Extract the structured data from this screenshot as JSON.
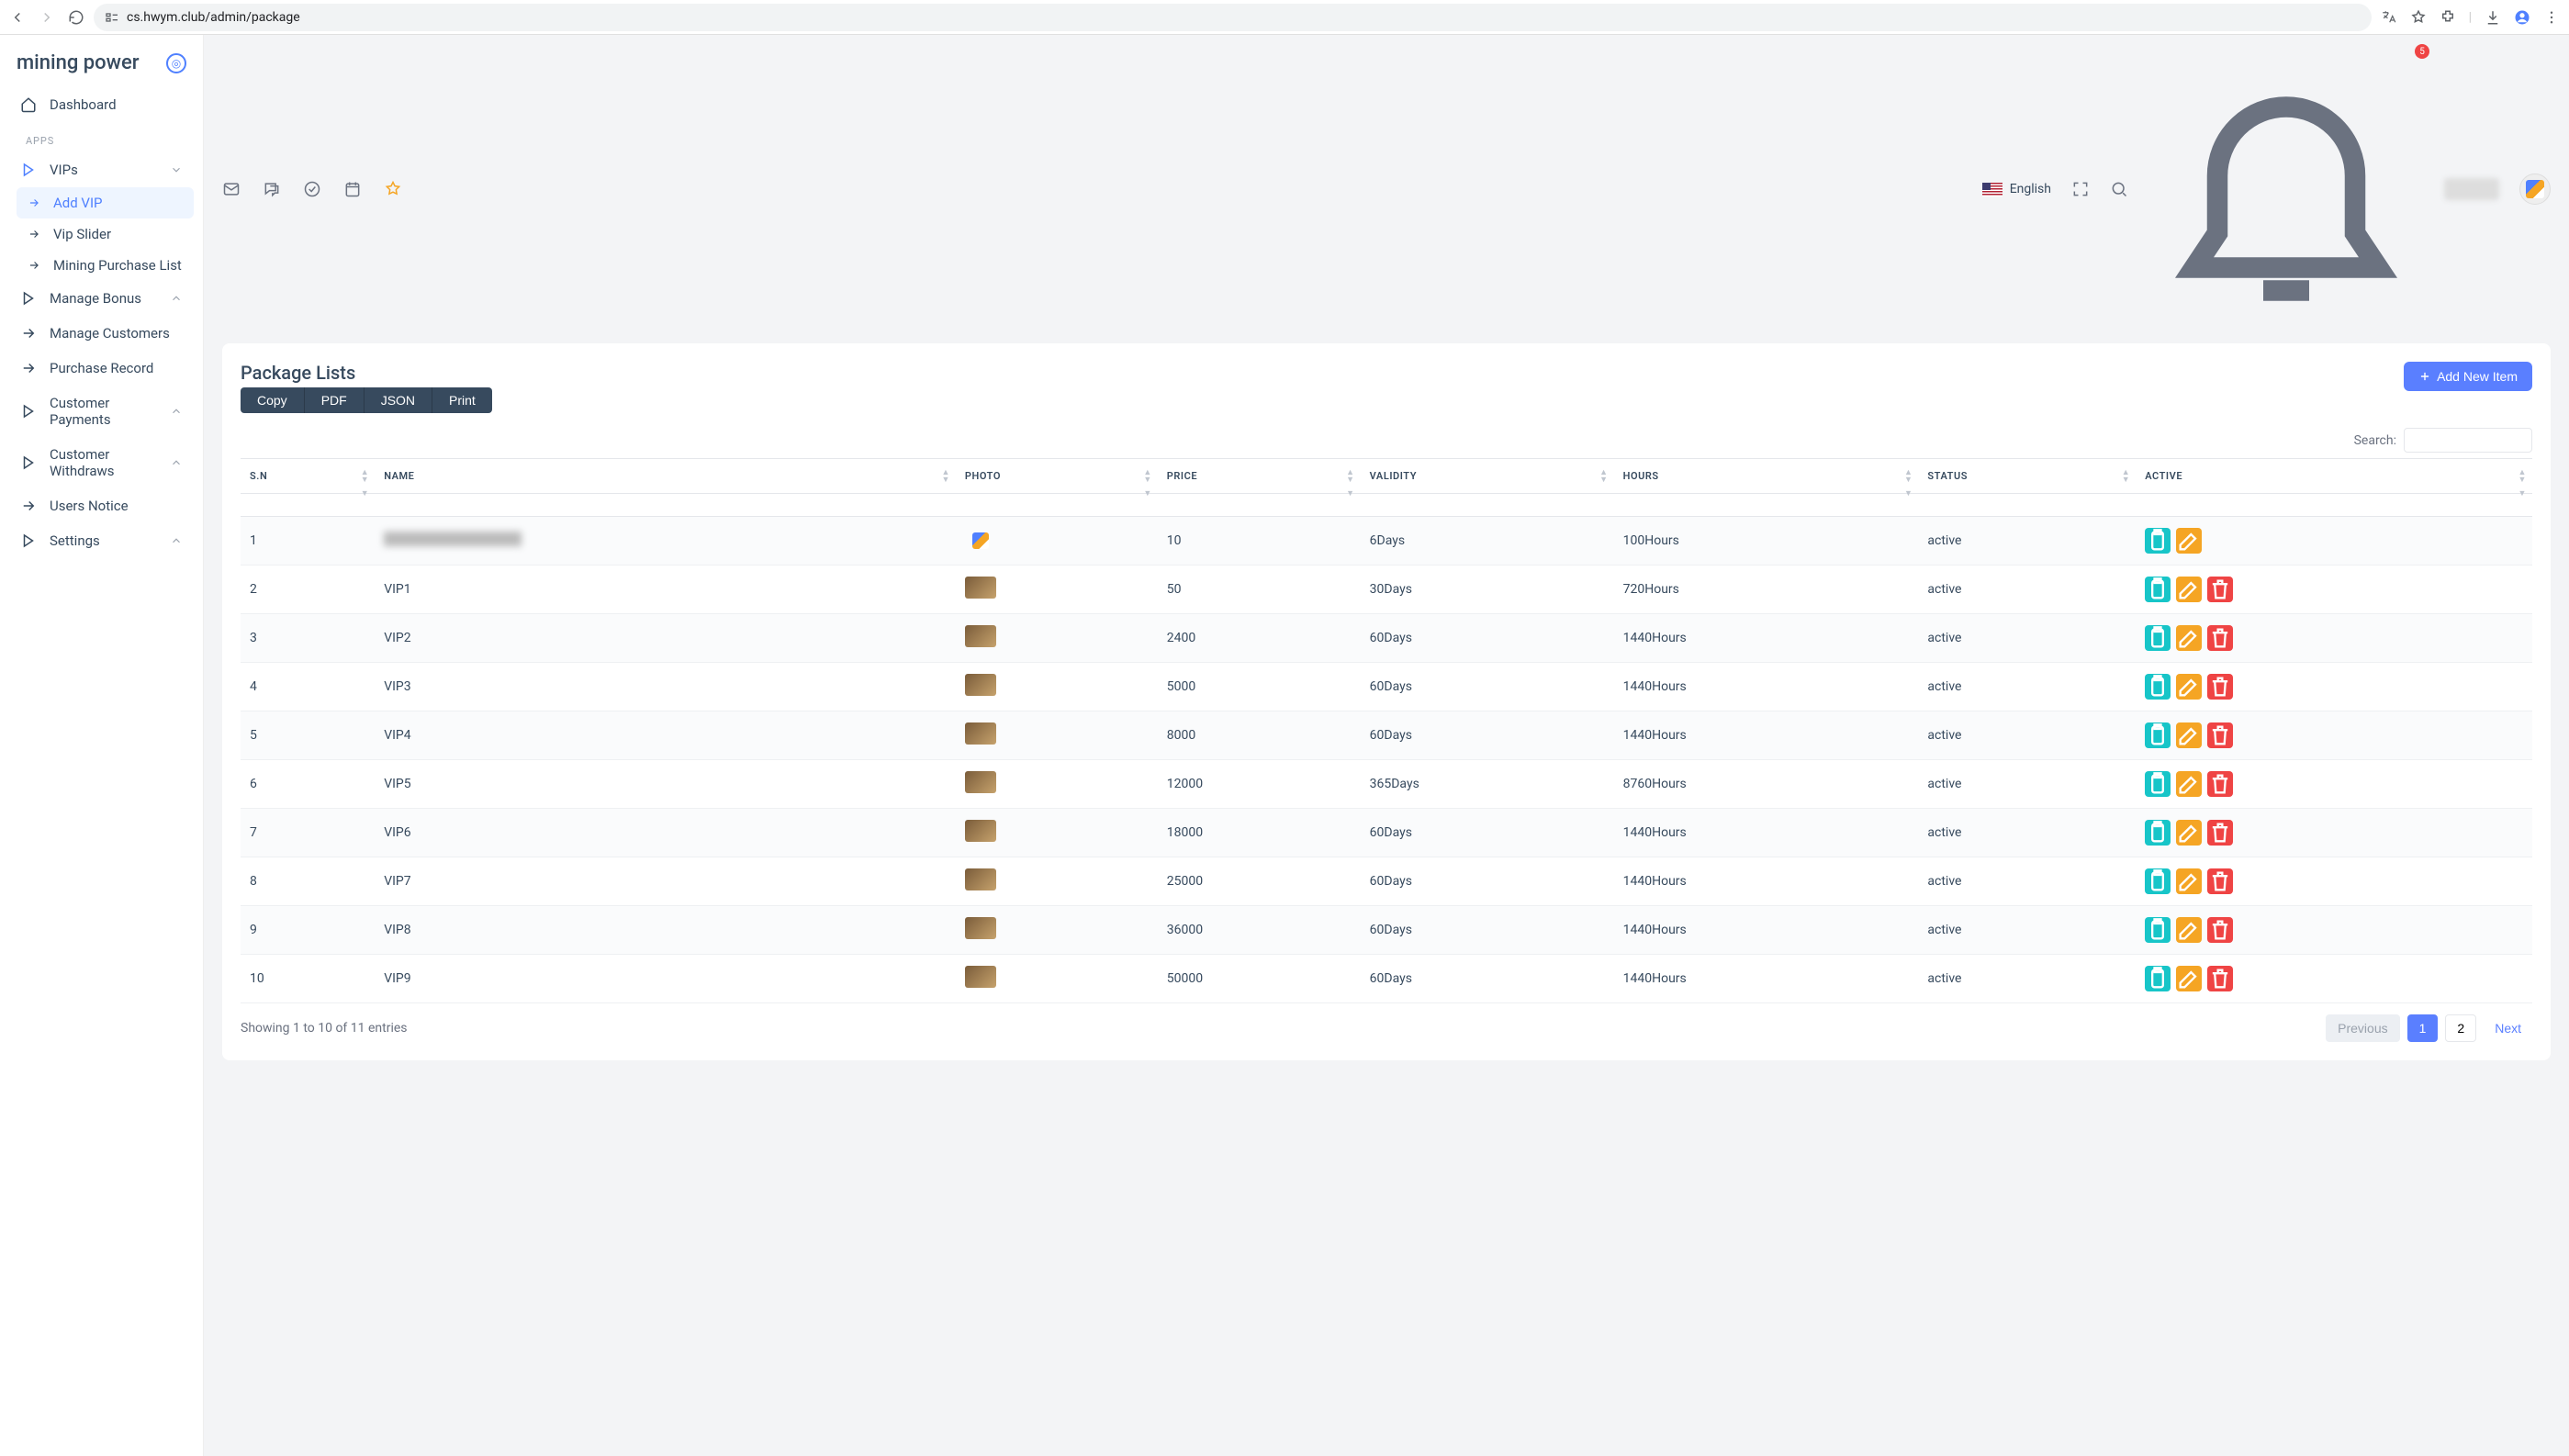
{
  "browser": {
    "url": "cs.hwym.club/admin/package"
  },
  "logo": "mining power",
  "sidebar": {
    "dashboard": "Dashboard",
    "section": "APPS",
    "items": [
      {
        "label": "VIPs",
        "expand": true
      },
      {
        "label": "Manage Bonus",
        "expand": true
      },
      {
        "label": "Manage Customers"
      },
      {
        "label": "Purchase Record"
      },
      {
        "label": "Customer Payments",
        "expand": true
      },
      {
        "label": "Customer Withdraws",
        "expand": true
      },
      {
        "label": "Users Notice"
      },
      {
        "label": "Settings",
        "expand": true
      }
    ],
    "vipsub": [
      "Add VIP",
      "Vip Slider",
      "Mining Purchase List"
    ]
  },
  "topbar": {
    "language": "English",
    "bell_count": "5"
  },
  "page": {
    "title": "Package Lists",
    "add_btn": "Add New Item",
    "export": [
      "Copy",
      "PDF",
      "JSON",
      "Print"
    ],
    "search_label": "Search:",
    "columns": [
      "S.N",
      "NAME",
      "PHOTO",
      "PRICE",
      "VALIDITY",
      "HOURS",
      "STATUS",
      "ACTIVE"
    ],
    "rows": [
      {
        "sn": "1",
        "name": "████ █████",
        "price": "10",
        "validity": "6Days",
        "hours": "100Hours",
        "status": "active",
        "del": false,
        "blur": true
      },
      {
        "sn": "2",
        "name": "VIP1",
        "price": "50",
        "validity": "30Days",
        "hours": "720Hours",
        "status": "active",
        "del": true
      },
      {
        "sn": "3",
        "name": "VIP2",
        "price": "2400",
        "validity": "60Days",
        "hours": "1440Hours",
        "status": "active",
        "del": true
      },
      {
        "sn": "4",
        "name": "VIP3",
        "price": "5000",
        "validity": "60Days",
        "hours": "1440Hours",
        "status": "active",
        "del": true
      },
      {
        "sn": "5",
        "name": "VIP4",
        "price": "8000",
        "validity": "60Days",
        "hours": "1440Hours",
        "status": "active",
        "del": true
      },
      {
        "sn": "6",
        "name": "VIP5",
        "price": "12000",
        "validity": "365Days",
        "hours": "8760Hours",
        "status": "active",
        "del": true
      },
      {
        "sn": "7",
        "name": "VIP6",
        "price": "18000",
        "validity": "60Days",
        "hours": "1440Hours",
        "status": "active",
        "del": true
      },
      {
        "sn": "8",
        "name": "VIP7",
        "price": "25000",
        "validity": "60Days",
        "hours": "1440Hours",
        "status": "active",
        "del": true
      },
      {
        "sn": "9",
        "name": "VIP8",
        "price": "36000",
        "validity": "60Days",
        "hours": "1440Hours",
        "status": "active",
        "del": true
      },
      {
        "sn": "10",
        "name": "VIP9",
        "price": "50000",
        "validity": "60Days",
        "hours": "1440Hours",
        "status": "active",
        "del": true
      }
    ],
    "footer_info": "Showing 1 to 10 of 11 entries",
    "pager": {
      "prev": "Previous",
      "next": "Next",
      "pages": [
        "1",
        "2"
      ]
    }
  }
}
